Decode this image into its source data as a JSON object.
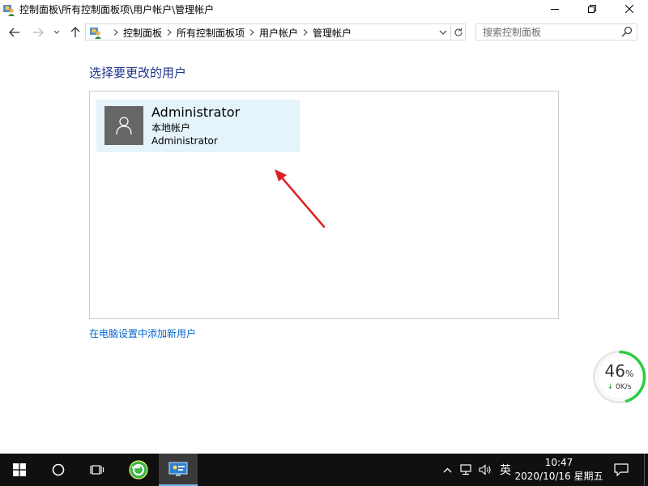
{
  "window": {
    "title": "控制面板\\所有控制面板项\\用户帐户\\管理帐户",
    "icon": "users-control-panel-icon"
  },
  "address": {
    "icon": "users-control-panel-icon",
    "crumbs": [
      "控制面板",
      "所有控制面板项",
      "用户帐户",
      "管理帐户"
    ]
  },
  "search": {
    "placeholder": "搜索控制面板"
  },
  "main": {
    "heading": "选择要更改的用户",
    "user": {
      "name": "Administrator",
      "type": "本地帐户",
      "group": "Administrator"
    },
    "add_link": "在电脑设置中添加新用户"
  },
  "speed_widget": {
    "percent": "46",
    "percent_unit": "%",
    "percent_value": 46,
    "rate": "0K/s",
    "ring_color": "#2ecc40"
  },
  "taskbar": {
    "ime": "英",
    "time": "10:47",
    "date": "2020/10/16 星期五"
  },
  "colors": {
    "heading": "#1e3287",
    "link": "#0066cc",
    "tile_bg": "#e5f3fb",
    "arrow": "#e02020",
    "taskbar": "#101010"
  }
}
